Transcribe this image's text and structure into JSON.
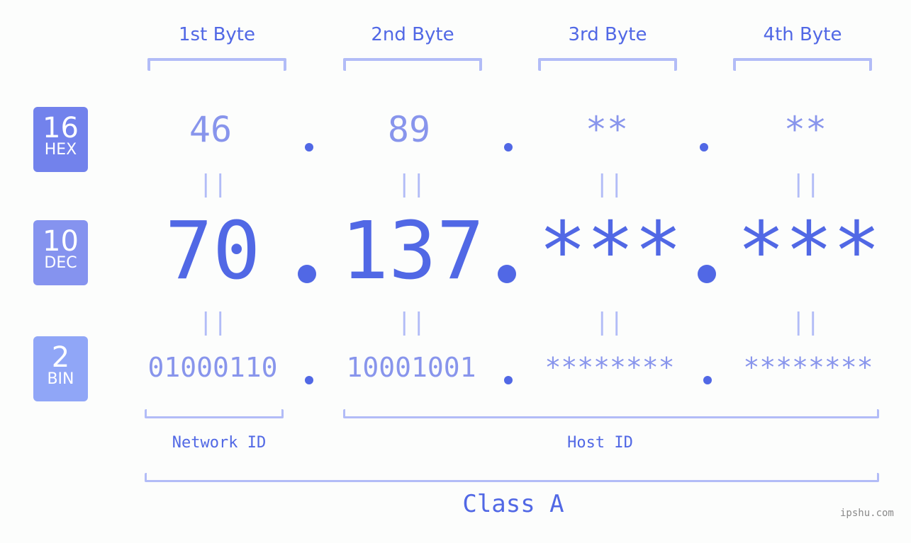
{
  "byte_headers": [
    "1st Byte",
    "2nd Byte",
    "3rd Byte",
    "4th Byte"
  ],
  "badges": {
    "hex": {
      "number": "16",
      "label": "HEX",
      "color": "#7282ec"
    },
    "dec": {
      "number": "10",
      "label": "DEC",
      "color": "#8593ef"
    },
    "bin": {
      "number": "2",
      "label": "BIN",
      "color": "#90a6f7"
    }
  },
  "hex_values": [
    "46",
    "89",
    "**",
    "**"
  ],
  "dec_values": [
    "70",
    "137",
    "***",
    "***"
  ],
  "bin_values": [
    "01000110",
    "10001001",
    "********",
    "********"
  ],
  "equals_symbol": "||",
  "network_id_label": "Network ID",
  "host_id_label": "Host ID",
  "class_label": "Class A",
  "watermark": "ipshu.com",
  "colors": {
    "accent": "#5168e5",
    "light_text": "#8895ec",
    "bracket": "#b2bcf7",
    "background": "#fcfdfc"
  }
}
